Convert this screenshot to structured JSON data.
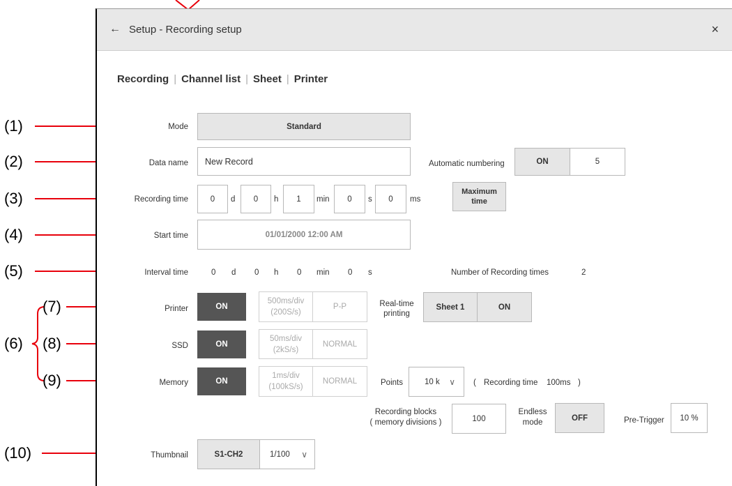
{
  "window": {
    "title": "Setup - Recording setup",
    "back_icon": "←",
    "close_icon": "×"
  },
  "tabs": [
    "Recording",
    "Channel list",
    "Sheet",
    "Printer"
  ],
  "callouts": [
    "(1)",
    "(2)",
    "(3)",
    "(4)",
    "(5)",
    "(6)",
    "(7)",
    "(8)",
    "(9)",
    "(10)"
  ],
  "mode": {
    "label": "Mode",
    "value": "Standard"
  },
  "data_name": {
    "label": "Data name",
    "value": "New Record",
    "auto_label": "Automatic numbering",
    "auto_state": "ON",
    "auto_value": "5"
  },
  "recording_time": {
    "label": "Recording time",
    "fields": [
      {
        "value": "0",
        "unit": "d"
      },
      {
        "value": "0",
        "unit": "h"
      },
      {
        "value": "1",
        "unit": "min"
      },
      {
        "value": "0",
        "unit": "s"
      },
      {
        "value": "0",
        "unit": "ms"
      }
    ],
    "max_button_line1": "Maximum",
    "max_button_line2": "time"
  },
  "start_time": {
    "label": "Start time",
    "value": "01/01/2000 12:00 AM"
  },
  "interval_time": {
    "label": "Interval time",
    "fields": [
      {
        "value": "0",
        "unit": "d"
      },
      {
        "value": "0",
        "unit": "h"
      },
      {
        "value": "0",
        "unit": "min"
      },
      {
        "value": "0",
        "unit": "s"
      }
    ],
    "count_label": "Number of Recording times",
    "count_value": "2"
  },
  "printer": {
    "label": "Printer",
    "state": "ON",
    "rate_line1": "500ms/div",
    "rate_line2": "(200S/s)",
    "mode": "P-P",
    "realtime_line1": "Real-time",
    "realtime_line2": "printing",
    "sheet": "Sheet 1",
    "realtime_state": "ON"
  },
  "ssd": {
    "label": "SSD",
    "state": "ON",
    "rate_line1": "50ms/div",
    "rate_line2": "(2kS/s)",
    "mode": "NORMAL"
  },
  "memory": {
    "label": "Memory",
    "state": "ON",
    "rate_line1": "1ms/div",
    "rate_line2": "(100kS/s)",
    "mode": "NORMAL",
    "points_label": "Points",
    "points_value": "10 k",
    "chevron": "∨",
    "rec_open": "(",
    "rec_label": "Recording time",
    "rec_value": "100ms",
    "rec_close": ")"
  },
  "blocks": {
    "label_line1": "Recording blocks",
    "label_line2": "( memory divisions )",
    "value": "100",
    "endless_line1": "Endless",
    "endless_line2": "mode",
    "endless_state": "OFF",
    "pretrigger_label": "Pre-Trigger",
    "pretrigger_value": "10 %"
  },
  "thumbnail": {
    "label": "Thumbnail",
    "channel": "S1-CH2",
    "scale": "1/100",
    "chevron": "∨"
  },
  "colors": {
    "annotation_red": "#e8000b",
    "titlebar": "#e8e8e8",
    "on_button": "#555555",
    "gray_button": "#e6e6e6"
  }
}
